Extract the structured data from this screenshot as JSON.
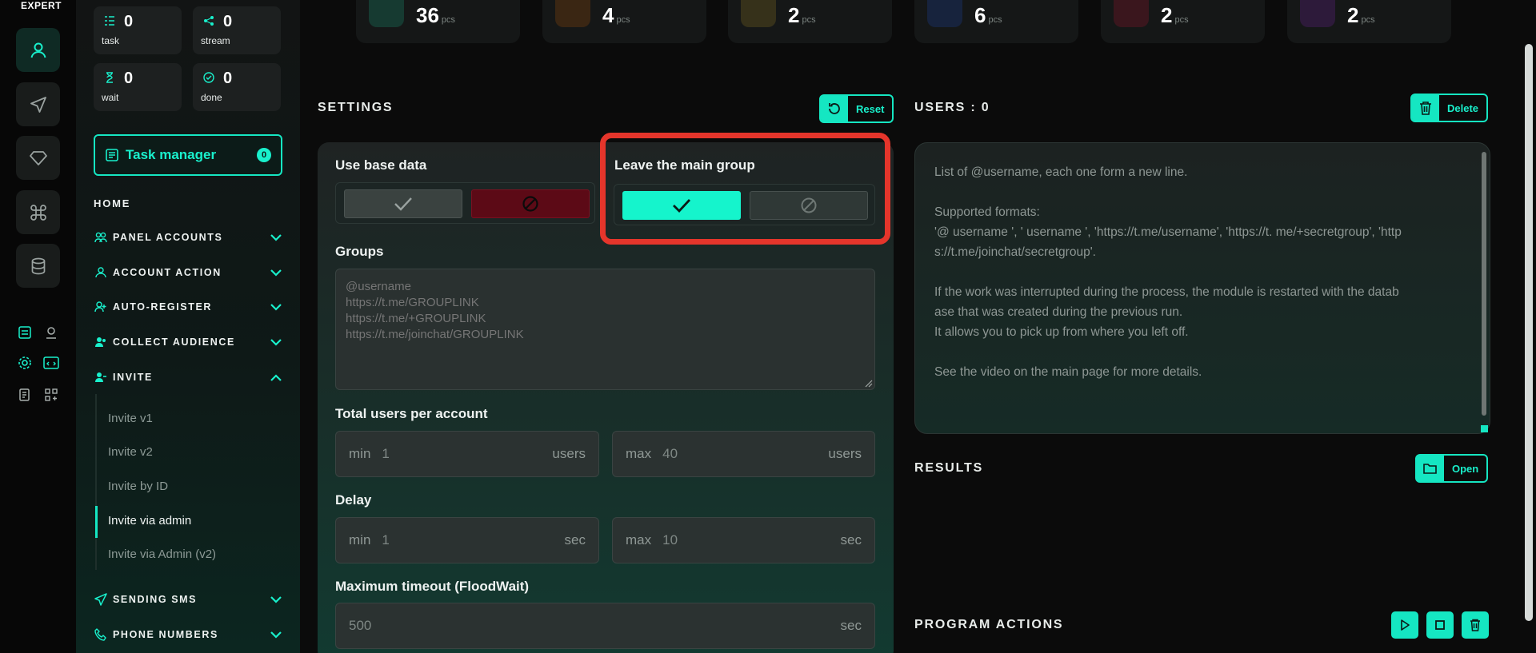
{
  "brand": "EXPERT",
  "sidebar": {
    "stats": [
      {
        "value": "0",
        "label": "task",
        "icon": "list-icon"
      },
      {
        "value": "0",
        "label": "stream",
        "icon": "share-icon"
      },
      {
        "value": "0",
        "label": "wait",
        "icon": "hourglass-icon"
      },
      {
        "value": "0",
        "label": "done",
        "icon": "check-circle-icon"
      }
    ],
    "task_manager": {
      "label": "Task manager",
      "count": "0"
    },
    "home": "HOME",
    "nav": [
      {
        "label": "PANEL ACCOUNTS",
        "icon": "users-icon",
        "expanded": false
      },
      {
        "label": "ACCOUNT ACTION",
        "icon": "user-icon",
        "expanded": false
      },
      {
        "label": "AUTO-REGISTER",
        "icon": "user-plus-icon",
        "expanded": false
      },
      {
        "label": "COLLECT AUDIENCE",
        "icon": "user-group-icon",
        "expanded": false
      },
      {
        "label": "INVITE",
        "icon": "user-invite-icon",
        "expanded": true
      },
      {
        "label": "SENDING SMS",
        "icon": "send-icon",
        "expanded": false
      },
      {
        "label": "PHONE NUMBERS",
        "icon": "phone-icon",
        "expanded": false
      }
    ],
    "invite_sub": [
      "Invite v1",
      "Invite v2",
      "Invite by ID",
      "Invite via admin",
      "Invite via Admin (v2)"
    ],
    "active_sub": "Invite via admin"
  },
  "top_tiles": [
    {
      "value": "36",
      "unit": "pcs",
      "color": "#1f6b55"
    },
    {
      "value": "4",
      "unit": "pcs",
      "color": "#b0661c"
    },
    {
      "value": "2",
      "unit": "pcs",
      "color": "#a68d1c"
    },
    {
      "value": "6",
      "unit": "pcs",
      "color": "#2a56a8"
    },
    {
      "value": "2",
      "unit": "pcs",
      "color": "#a8283a"
    },
    {
      "value": "2",
      "unit": "pcs",
      "color": "#7d2fa8"
    }
  ],
  "settings": {
    "title": "SETTINGS",
    "reset_label": "Reset",
    "use_base_data": {
      "label": "Use base data",
      "value": "off"
    },
    "leave_main_group": {
      "label": "Leave the main group",
      "value": "on"
    },
    "groups": {
      "label": "Groups",
      "placeholder": "@username\nhttps://t.me/GROUPLINK\nhttps://t.me/+GROUPLINK\nhttps://t.me/joinchat/GROUPLINK"
    },
    "total_users": {
      "label": "Total users per account",
      "min_prefix": "min",
      "min_value": "1",
      "min_unit": "users",
      "max_prefix": "max",
      "max_value": "40",
      "max_unit": "users"
    },
    "delay": {
      "label": "Delay",
      "min_prefix": "min",
      "min_value": "1",
      "min_unit": "sec",
      "max_prefix": "max",
      "max_value": "10",
      "max_unit": "sec"
    },
    "floodwait": {
      "label": "Maximum timeout (FloodWait)",
      "value": "500",
      "unit": "sec"
    }
  },
  "users": {
    "title": "USERS : 0",
    "delete_label": "Delete",
    "placeholder_lines": [
      "List of @username, each one form a new line.",
      "",
      "Supported formats:",
      "'@ username ', ' username ', 'https://t.me/username', 'https://t. me/+secretgroup', 'http",
      "s://t.me/joinchat/secretgroup'.",
      "",
      "If the work was interrupted during the process, the module is restarted with the datab",
      "ase that was created during the previous run.",
      "It allows you to pick up from where you left off.",
      "",
      "See the video on the main page for more details."
    ]
  },
  "results": {
    "title": "RESULTS",
    "open_label": "Open"
  },
  "program_actions": {
    "title": "PROGRAM ACTIONS"
  },
  "colors": {
    "accent": "#15e6c2",
    "danger": "#e5352b",
    "background": "#0b0b0b"
  }
}
